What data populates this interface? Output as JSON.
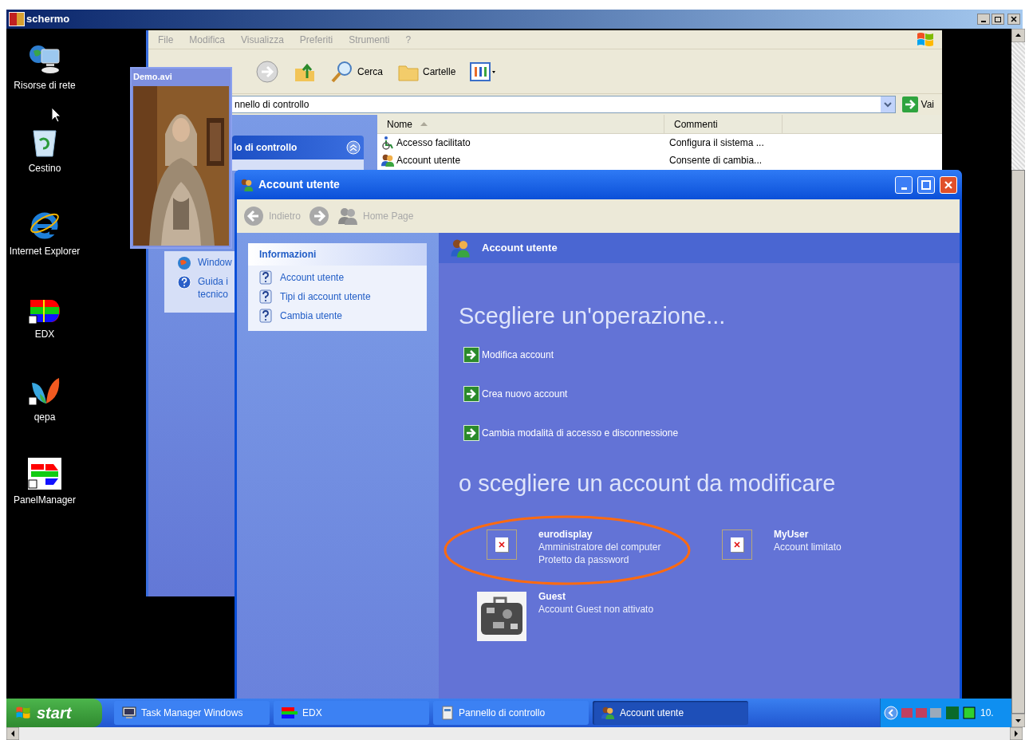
{
  "remote_window": {
    "title": "schermo"
  },
  "desktop_icons": [
    {
      "label": "Risorse di rete",
      "kind": "network"
    },
    {
      "label": "Cestino",
      "kind": "recycle"
    },
    {
      "label": "Internet Explorer",
      "kind": "browser"
    },
    {
      "label": "EDX",
      "kind": "edx"
    },
    {
      "label": "qepa",
      "kind": "butterfly"
    },
    {
      "label": "PanelManager",
      "kind": "panel"
    }
  ],
  "explorer": {
    "menu": [
      "File",
      "Modifica",
      "Visualizza",
      "Preferiti",
      "Strumenti",
      "?"
    ],
    "toolbar": [
      {
        "kind": "forward"
      },
      {
        "kind": "up"
      },
      {
        "kind": "search",
        "label": "Cerca"
      },
      {
        "kind": "folders",
        "label": "Cartelle"
      },
      {
        "kind": "views"
      }
    ],
    "address": "nnello di controllo",
    "go_button": "Vai",
    "task_title": "lo di controllo",
    "side_links": [
      {
        "lines": [
          "Window"
        ],
        "kind": "windows"
      },
      {
        "lines": [
          "Guida i",
          "tecnico"
        ],
        "kind": "help"
      }
    ],
    "columns": [
      "Nome",
      "Commenti"
    ],
    "rows": [
      {
        "name": "Accesso facilitato",
        "comment": "Configura il sistema ...",
        "kind": "access"
      },
      {
        "name": "Account utente",
        "comment": "Consente di cambia...",
        "kind": "users"
      }
    ]
  },
  "video": {
    "title": "Demo.avi"
  },
  "accounts_window": {
    "title": "Account utente",
    "nav": [
      {
        "label": "Indietro",
        "kind": "back",
        "disabled": true
      },
      {
        "kind": "forward",
        "disabled": true
      },
      {
        "label": "Home Page",
        "kind": "home",
        "disabled": true
      }
    ],
    "info_title": "Informazioni",
    "info_links": [
      "Account utente",
      "Tipi di account utente",
      "Cambia utente"
    ],
    "header": "Account utente",
    "heading_tasks": "Scegliere un'operazione...",
    "tasks": [
      "Modifica account",
      "Crea nuovo account",
      "Cambia modalità di accesso e disconnessione"
    ],
    "heading_accounts": "o scegliere un account da modificare",
    "accounts": [
      {
        "name": "eurodisplay",
        "lines": [
          "Amministratore del computer",
          "Protetto da password"
        ],
        "kind": "broken",
        "highlighted": true
      },
      {
        "name": "MyUser",
        "lines": [
          "Account limitato"
        ],
        "kind": "broken",
        "highlighted": false
      },
      {
        "name": "Guest",
        "lines": [
          "Account Guest non attivato"
        ],
        "kind": "suitcase",
        "highlighted": false
      }
    ]
  },
  "taskbar": {
    "start": "start",
    "buttons": [
      {
        "label": "Task Manager Windows",
        "kind": "monitor",
        "selected": false
      },
      {
        "label": "EDX",
        "kind": "edx",
        "selected": false
      },
      {
        "label": "Pannello di controllo",
        "kind": "panel",
        "selected": false
      },
      {
        "label": "Account utente",
        "kind": "users",
        "selected": true
      }
    ],
    "clock": "10."
  }
}
